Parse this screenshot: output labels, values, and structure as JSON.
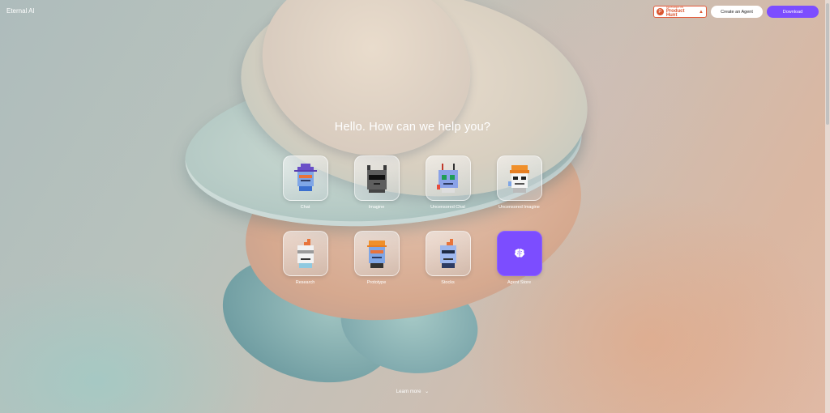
{
  "header": {
    "brand": "Eternal AI",
    "product_hunt_small": "FEATURED ON",
    "product_hunt_big": "Product Hunt",
    "product_hunt_count": "▲",
    "create_agent": "Create an Agent",
    "download": "Download"
  },
  "main": {
    "headline": "Hello. How can we help you?",
    "tiles": [
      {
        "label": "Chat"
      },
      {
        "label": "Imagine"
      },
      {
        "label": "Uncensored Chat"
      },
      {
        "label": "Uncensored Imagine"
      },
      {
        "label": "Research"
      },
      {
        "label": "Prototype"
      },
      {
        "label": "Stocks"
      },
      {
        "label": "Agent Store"
      }
    ]
  },
  "footer": {
    "learn_more": "Learn more",
    "chevron": "⌄"
  },
  "colors": {
    "accent": "#7c4dff",
    "product_hunt": "#da552f"
  }
}
